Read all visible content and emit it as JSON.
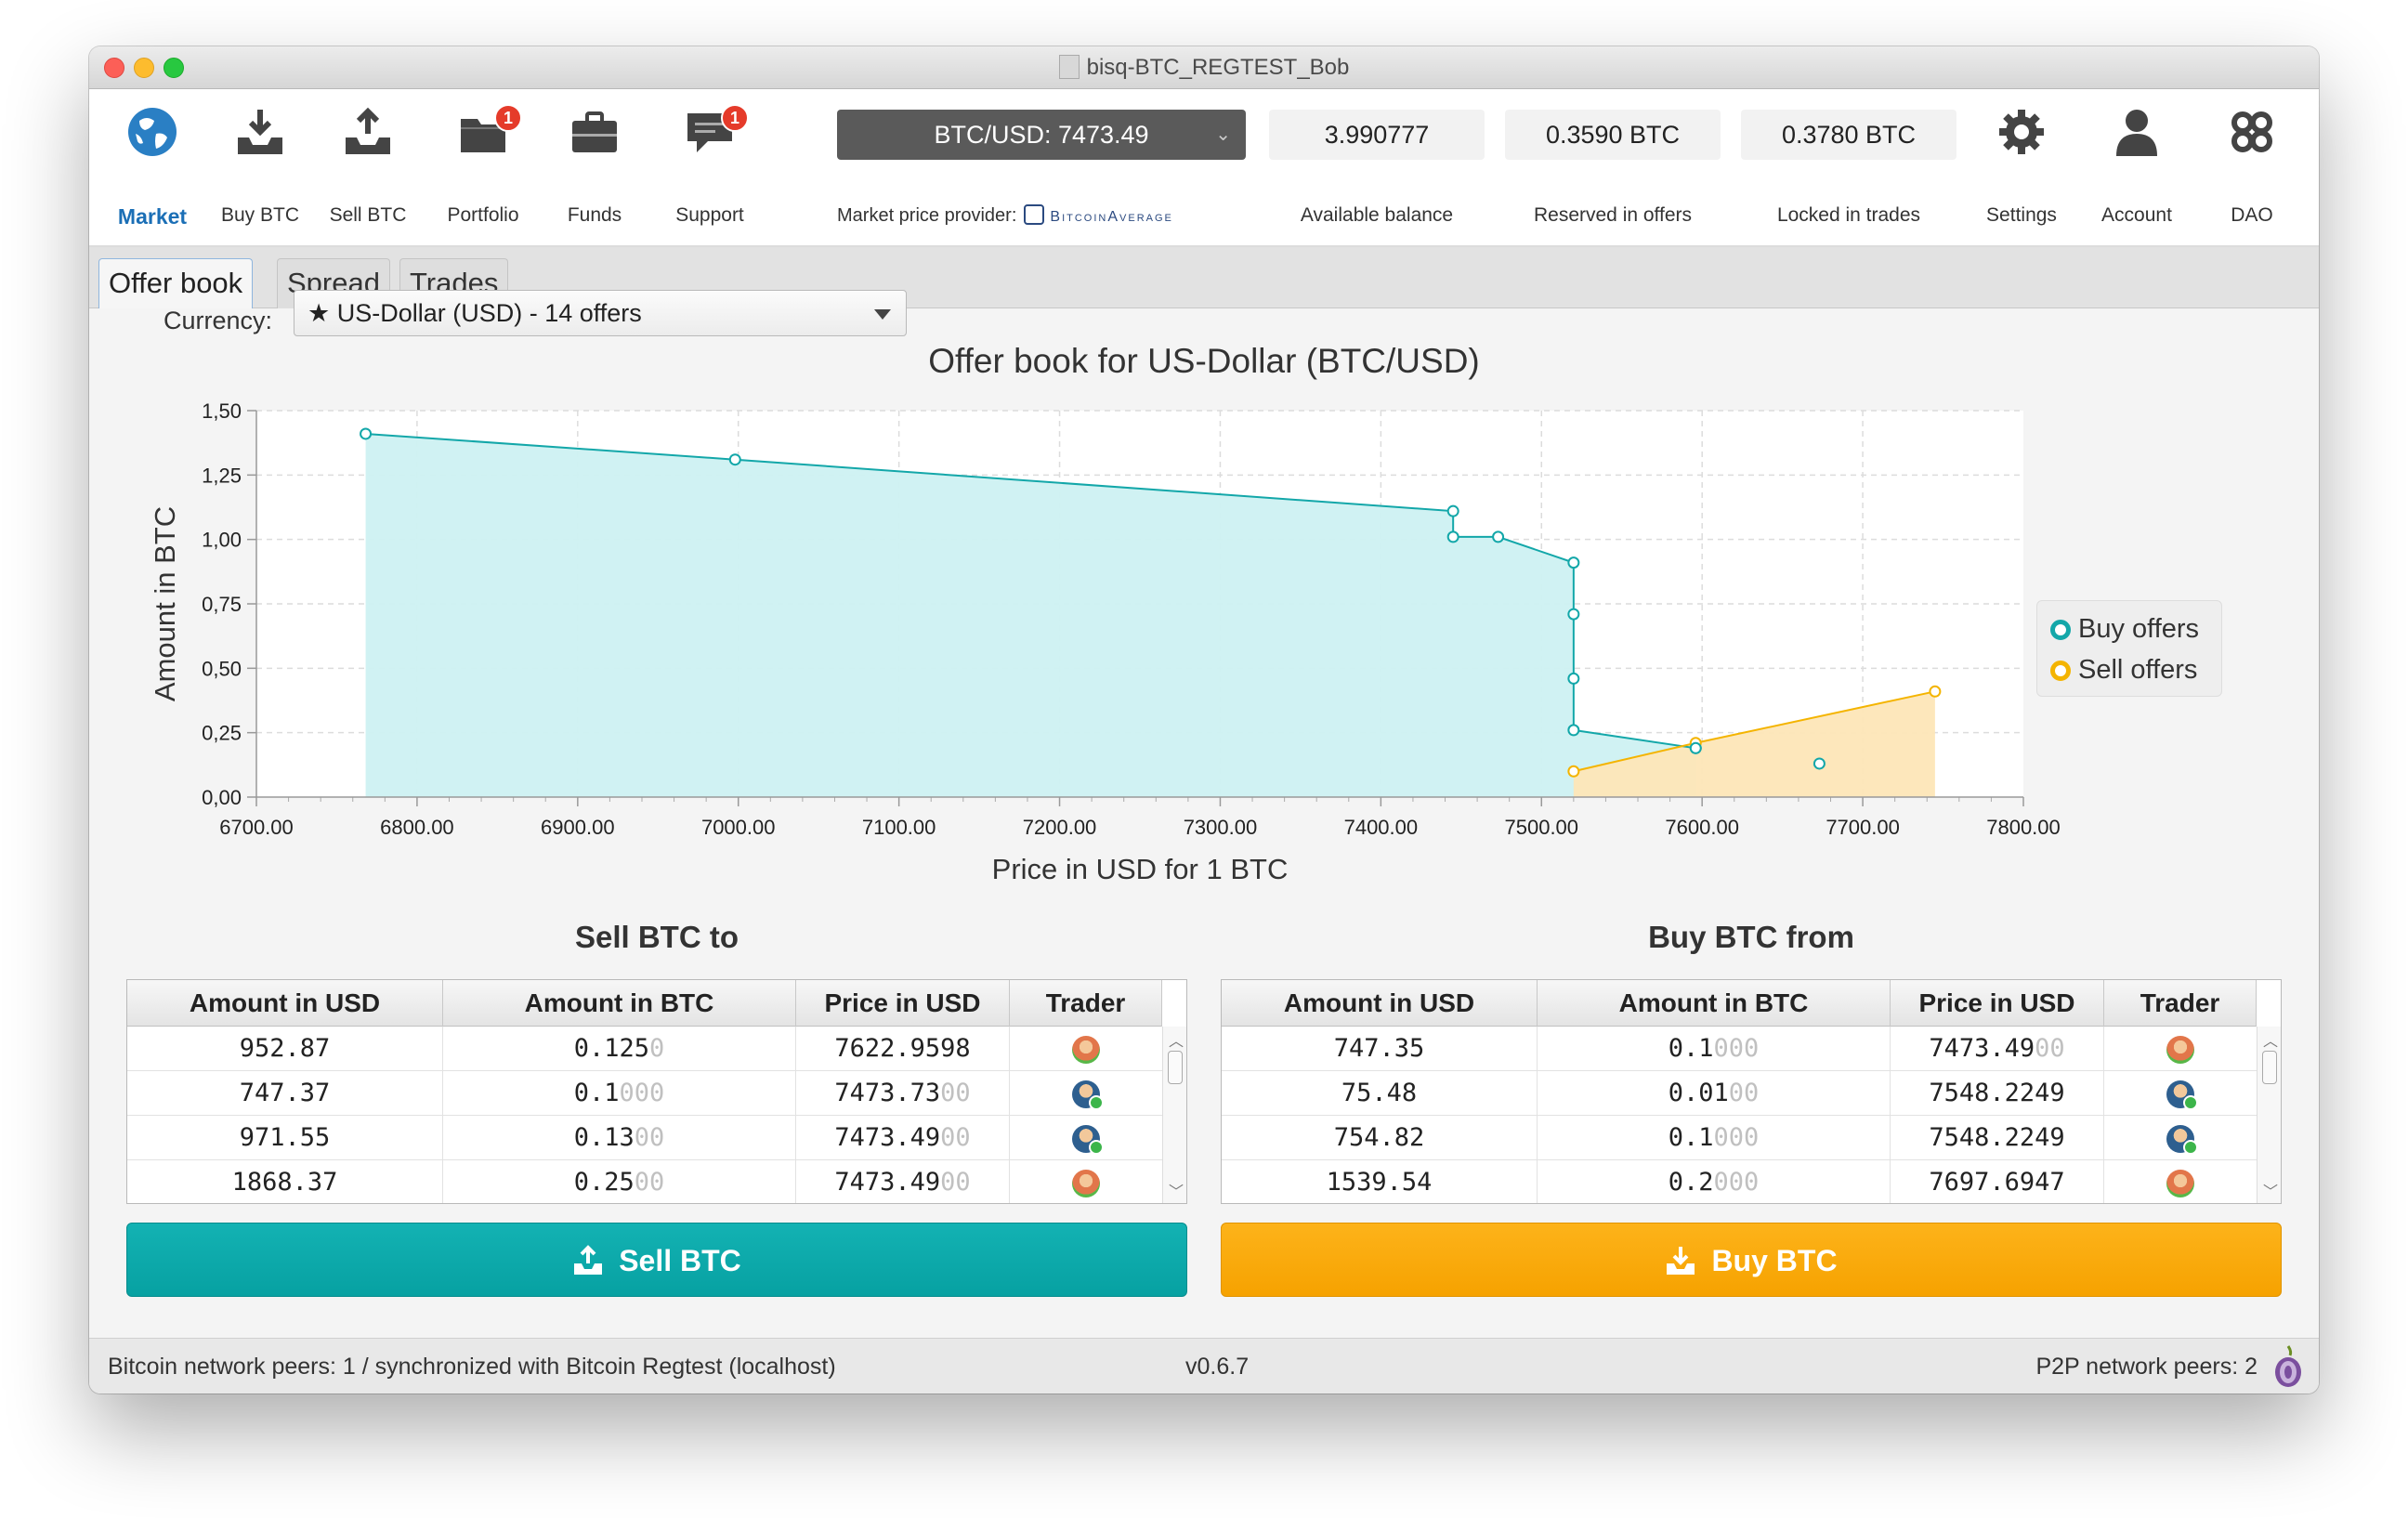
{
  "window": {
    "title": "bisq-BTC_REGTEST_Bob"
  },
  "toolbar": {
    "nav": [
      {
        "label": "Market",
        "icon": "globe-icon",
        "active": true
      },
      {
        "label": "Buy BTC",
        "icon": "buy-tray-icon"
      },
      {
        "label": "Sell BTC",
        "icon": "sell-tray-icon"
      },
      {
        "label": "Portfolio",
        "icon": "folder-icon",
        "badge": "1"
      },
      {
        "label": "Funds",
        "icon": "briefcase-icon"
      },
      {
        "label": "Support",
        "icon": "chat-bubble-icon",
        "badge": "1"
      }
    ],
    "market_price": "BTC/USD: 7473.49",
    "price_provider_label": "Market price provider:",
    "price_provider_name": "BitcoinAverage",
    "balances": [
      {
        "value": "3.990777",
        "label": "Available balance"
      },
      {
        "value": "0.3590 BTC",
        "label": "Reserved in offers"
      },
      {
        "value": "0.3780 BTC",
        "label": "Locked in trades"
      }
    ],
    "right_nav": [
      {
        "label": "Settings",
        "icon": "gear-icon"
      },
      {
        "label": "Account",
        "icon": "user-icon"
      },
      {
        "label": "DAO",
        "icon": "dao-icon"
      }
    ]
  },
  "tabs": [
    "Offer book",
    "Spread",
    "Trades"
  ],
  "currency": {
    "label": "Currency:",
    "value": "★ US-Dollar (USD) - 14 offers"
  },
  "chart_data": {
    "type": "area",
    "title": "Offer book for US-Dollar (BTC/USD)",
    "xlabel": "Price in USD for 1 BTC",
    "ylabel": "Amount in BTC",
    "xlim": [
      6700,
      7800
    ],
    "ylim": [
      0,
      1.5
    ],
    "x_ticks": [
      "6700.00",
      "6800.00",
      "6900.00",
      "7000.00",
      "7100.00",
      "7200.00",
      "7300.00",
      "7400.00",
      "7500.00",
      "7600.00",
      "7700.00",
      "7800.00"
    ],
    "y_ticks": [
      "0,00",
      "0,25",
      "0,50",
      "0,75",
      "1,00",
      "1,25",
      "1,50"
    ],
    "grid": true,
    "legend": "right",
    "series": [
      {
        "name": "Buy offers",
        "color": "#13a7a9",
        "fill": "#cdf1f2",
        "x": [
          6768,
          6998,
          7445,
          7445,
          7473,
          7520,
          7520,
          7520,
          7520,
          7596
        ],
        "y": [
          1.41,
          1.31,
          1.11,
          1.01,
          1.01,
          0.91,
          0.71,
          0.46,
          0.26,
          0.19
        ]
      },
      {
        "name": "Sell offers",
        "color": "#f4b400",
        "fill": "#fde6b7",
        "x": [
          7520,
          7596,
          7745
        ],
        "y": [
          0.1,
          0.21,
          0.41
        ]
      },
      {
        "name": "",
        "color": "#13a7a9",
        "fill": "none",
        "x": [
          7673
        ],
        "y": [
          0.13
        ]
      }
    ]
  },
  "sell_table": {
    "title": "Sell BTC to",
    "headers": [
      "Amount in USD",
      "Amount in BTC",
      "Price in USD",
      "Trader"
    ],
    "rows": [
      {
        "usd": "952.87",
        "btc": "0.125",
        "btc_dim": "0",
        "price": "7622.9598",
        "price_dim": "",
        "trader": "single"
      },
      {
        "usd": "747.37",
        "btc": "0.1",
        "btc_dim": "000",
        "price": "7473.73",
        "price_dim": "00",
        "trader": "multi"
      },
      {
        "usd": "971.55",
        "btc": "0.13",
        "btc_dim": "00",
        "price": "7473.49",
        "price_dim": "00",
        "trader": "multi"
      },
      {
        "usd": "1868.37",
        "btc": "0.25",
        "btc_dim": "00",
        "price": "7473.49",
        "price_dim": "00",
        "trader": "single"
      }
    ],
    "button": "Sell BTC"
  },
  "buy_table": {
    "title": "Buy BTC from",
    "headers": [
      "Amount in USD",
      "Amount in BTC",
      "Price in USD",
      "Trader"
    ],
    "rows": [
      {
        "usd": "747.35",
        "btc": "0.1",
        "btc_dim": "000",
        "price": "7473.49",
        "price_dim": "00",
        "trader": "single"
      },
      {
        "usd": "75.48",
        "btc": "0.01",
        "btc_dim": "00",
        "price": "7548.2249",
        "price_dim": "",
        "trader": "multi"
      },
      {
        "usd": "754.82",
        "btc": "0.1",
        "btc_dim": "000",
        "price": "7548.2249",
        "price_dim": "",
        "trader": "multi"
      },
      {
        "usd": "1539.54",
        "btc": "0.2",
        "btc_dim": "000",
        "price": "7697.6947",
        "price_dim": "",
        "trader": "single"
      }
    ],
    "button": "Buy BTC"
  },
  "status": {
    "btc_peers": "Bitcoin network peers: 1 / synchronized with Bitcoin Regtest (localhost)",
    "version": "v0.6.7",
    "p2p_peers": "P2P network peers: 2"
  },
  "colors": {
    "sell": "#0aa7a8",
    "buy": "#f8a900",
    "accent": "#1b6fb6"
  }
}
